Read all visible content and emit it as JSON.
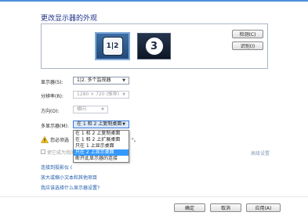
{
  "title": "更改显示器的外观",
  "preview": {
    "monitor1_label": "1|2",
    "monitor2_label": "3"
  },
  "buttons": {
    "detect": "检测(C)",
    "identify": "识别(I)",
    "ok": "确定",
    "cancel": "取消",
    "apply": "应用(A)"
  },
  "fields": {
    "display_label": "显示器(S):",
    "display_value": "1|2. 多个监视器",
    "resolution_label": "分辨率(R):",
    "resolution_value": "1280 × 720 (推荐)",
    "orientation_label": "方向(O):",
    "orientation_value": "横向",
    "multi_label": "多显示器(M):",
    "multi_value": "在 1 和 2 上复制桌面"
  },
  "multi_options": [
    "在 1 和 2 上复制桌面",
    "在 1 和 2 上扩展桌面",
    "只在 1 上显示桌面",
    "只在 2 上显示桌面",
    "断开此显示器的连接"
  ],
  "warning_text": "您必须选",
  "warning_suffix": "\"。",
  "checkbox_label": "使它成为我的",
  "advanced_link": "高级设置",
  "links": [
    "连接到投影仪 (",
    "放大或缩小文本和其他项目",
    "我应该选择什么显示器设置?"
  ]
}
